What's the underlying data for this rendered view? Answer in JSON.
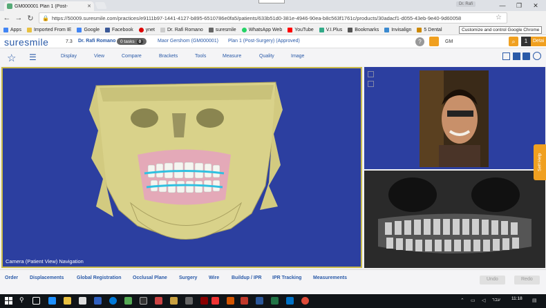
{
  "browser": {
    "tab_title": "GM000001 Plan 1 (Post-",
    "user_chip": "Dr. Rafi",
    "url": "https://50009.suresmile.com/practices/e9111b97-1441-4127-b895-6510786e0fa5/patients/633b51d0-381e-4946-90ea-b8c563f1761c/products/30adacf1-d055-43eb-9e40-9d60058",
    "tooltip": "Customize and control Google Chrome",
    "bookmarks": [
      "Apps",
      "Imported From IE",
      "Google",
      "Facebook",
      "ynet",
      "Dr. Rafi Romano",
      "suresmile",
      "WhatsApp Web",
      "YouTube",
      "V.I.Plus",
      "Bookmarks",
      "Invisalign",
      "5 Dental"
    ]
  },
  "app": {
    "logo": "suresmile",
    "version": "7.3",
    "doctor": "Dr. Rafi Romano",
    "tasks_label": "0 tasks",
    "tasks_count": "0",
    "patient": "Maor Gershom (GM000001)",
    "plan": "Plan 1 (Post-Surgery) (Approved)",
    "help": "?",
    "user_initials": "GM",
    "count": "1",
    "detail": "Detai"
  },
  "toolbar": {
    "items": [
      "Display",
      "View",
      "Compare",
      "Brackets",
      "Tools",
      "Measure",
      "Quality",
      "Image"
    ]
  },
  "viewport": {
    "camera_label": "Camera (Patient View) Navigation"
  },
  "self_help": "Self Help",
  "bottom_tabs": [
    "Order",
    "Displacements",
    "Global Registration",
    "Occlusal Plane",
    "Surgery",
    "Wire",
    "Buildup / IPR",
    "IPR Tracking",
    "Measurements"
  ],
  "undo": "Undo",
  "redo": "Redo",
  "taskbar": {
    "time": "11:18",
    "lang": "עבר"
  },
  "colors": {
    "brand_blue": "#2a5aa8",
    "accent_orange": "#f0a020",
    "viewport_bg": "#2c3fa0",
    "viewport_border": "#c8b94a"
  }
}
